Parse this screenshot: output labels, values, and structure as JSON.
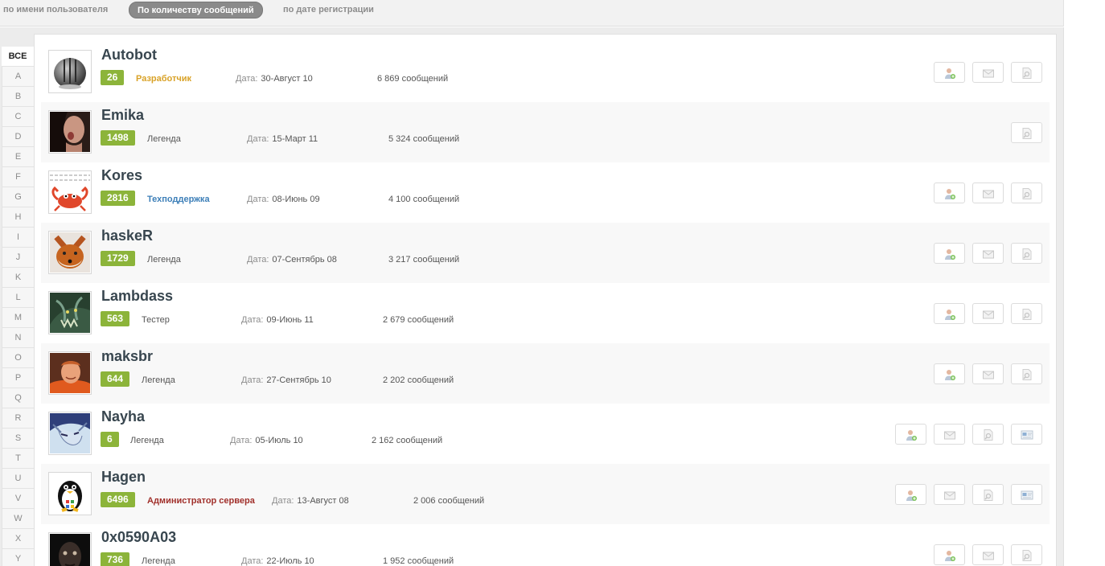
{
  "sort_tabs": [
    {
      "label": "по имени пользователя",
      "active": false
    },
    {
      "label": "По количеству сообщений",
      "active": true
    },
    {
      "label": "по дате регистрации",
      "active": false
    }
  ],
  "letters": [
    "ВСЕ",
    "A",
    "B",
    "C",
    "D",
    "E",
    "F",
    "G",
    "H",
    "I",
    "J",
    "K",
    "L",
    "M",
    "N",
    "O",
    "P",
    "Q",
    "R",
    "S",
    "T",
    "U",
    "V",
    "W",
    "X",
    "Y"
  ],
  "date_label": "Дата:",
  "members": [
    {
      "name": "Autobot",
      "rep": "26",
      "group": "Разработчик",
      "group_style": "dev",
      "date": "30-Август 10",
      "posts": "6 869 сообщений",
      "avatar": "helmet-avatar",
      "actions": [
        "add-friend-icon",
        "message-icon",
        "find-posts-icon"
      ]
    },
    {
      "name": "Emika",
      "rep": "1498",
      "group": "Легенда",
      "group_style": "plain",
      "date": "15-Март 11",
      "posts": "5 324 сообщений",
      "avatar": "girl-avatar",
      "actions": [
        "find-posts-icon"
      ]
    },
    {
      "name": "Kores",
      "rep": "2816",
      "group": "Техподдержка",
      "group_style": "sup",
      "date": "08-Июнь 09",
      "posts": "4 100 сообщений",
      "avatar": "crab-avatar",
      "actions": [
        "add-friend-icon",
        "message-icon",
        "find-posts-icon"
      ]
    },
    {
      "name": "haskeR",
      "rep": "1729",
      "group": "Легенда",
      "group_style": "plain",
      "date": "07-Сентябрь 08",
      "posts": "3 217 сообщений",
      "avatar": "fox-avatar",
      "actions": [
        "add-friend-icon",
        "message-icon",
        "find-posts-icon"
      ]
    },
    {
      "name": "Lambdass",
      "rep": "563",
      "group": "Тестер",
      "group_style": "plain",
      "date": "09-Июнь 11",
      "posts": "2 679 сообщений",
      "avatar": "monster-avatar",
      "actions": [
        "add-friend-icon",
        "message-icon",
        "find-posts-icon"
      ]
    },
    {
      "name": "maksbr",
      "rep": "644",
      "group": "Легенда",
      "group_style": "plain",
      "date": "27-Сентябрь 10",
      "posts": "2 202 сообщений",
      "avatar": "man-avatar",
      "actions": [
        "add-friend-icon",
        "message-icon",
        "find-posts-icon"
      ]
    },
    {
      "name": "Nayha",
      "rep": "6",
      "group": "Легенда",
      "group_style": "plain",
      "date": "05-Июль 10",
      "posts": "2 162 сообщений",
      "avatar": "elf-avatar",
      "actions": [
        "add-friend-icon",
        "message-icon",
        "find-posts-icon",
        "card-icon"
      ]
    },
    {
      "name": "Hagen",
      "rep": "6496",
      "group": "Администратор сервера",
      "group_style": "adm",
      "date": "13-Август 08",
      "posts": "2 006 сообщений",
      "avatar": "penguin-avatar",
      "actions": [
        "add-friend-icon",
        "message-icon",
        "find-posts-icon",
        "card-icon"
      ]
    },
    {
      "name": "0x0590A03",
      "rep": "736",
      "group": "Легенда",
      "group_style": "plain",
      "date": "22-Июль 10",
      "posts": "1 952 сообщений",
      "avatar": "dark-avatar",
      "actions": [
        "add-friend-icon",
        "message-icon",
        "find-posts-icon"
      ]
    }
  ]
}
